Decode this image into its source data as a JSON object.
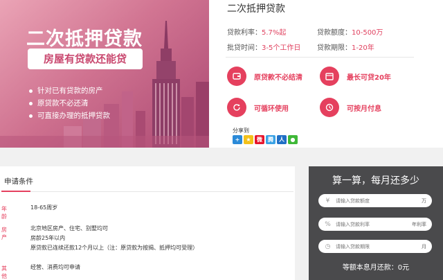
{
  "banner": {
    "title": "二次抵押贷款",
    "tag": "房屋有贷款还能贷",
    "points": [
      "针对已有贷款的房产",
      "原贷款不必还清",
      "可直接办理的抵押贷款"
    ]
  },
  "product": {
    "title": "二次抵押贷款",
    "rate_label": "贷款利率：",
    "rate_value": "5.7%起",
    "amount_label": "贷款额度：",
    "amount_value": "10-500万",
    "approval_label": "批贷时间：",
    "approval_value": "3-5个工作日",
    "term_label": "贷款期限：",
    "term_value": "1-20年",
    "features": [
      "原贷款不必结清",
      "最长可贷20年",
      "可循环使用",
      "可按月付息"
    ],
    "share_label": "分享到"
  },
  "conditions": {
    "title": "申请条件",
    "rows": [
      {
        "label": "年龄",
        "lines": [
          "18-65周岁"
        ]
      },
      {
        "label": "房产",
        "lines": [
          "北京地区房产、住宅、别墅均可",
          "房龄25年以内",
          "原贷款已连续还款12个月以上（注：原贷款为按揭、抵押均可受理）"
        ]
      },
      {
        "label": "其他",
        "lines": [
          "经营、消费均可申请"
        ]
      }
    ]
  },
  "calculator": {
    "title": "算一算，每月还多少",
    "amount_placeholder": "请输入贷款额度",
    "amount_unit": "万",
    "rate_placeholder": "请输入贷款利率",
    "rate_unit": "年利率",
    "term_placeholder": "请输入贷款期限",
    "term_unit": "月",
    "result": "等额本息月还款：0元"
  },
  "colors": {
    "accent": "#e5405e",
    "calc_bg": "#4a4a4c"
  }
}
